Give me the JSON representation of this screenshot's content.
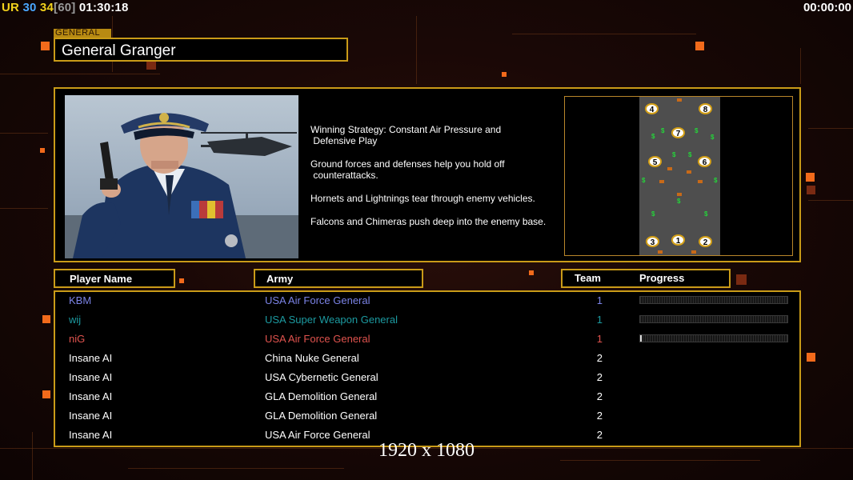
{
  "hud": {
    "ur_label": "UR",
    "value_a": "30",
    "value_b": "34",
    "value_c": "[60]",
    "clock": "01:30:18",
    "timer": "00:00:00"
  },
  "general": {
    "tag": "GENERAL",
    "name": "General Granger",
    "strategy_lines": [
      "Winning Strategy: Constant Air Pressure and\n Defensive Play",
      "Ground forces and defenses help you hold off\n counterattacks.",
      "Hornets and Lightnings tear through enemy vehicles.",
      "Falcons and Chimeras push deep into the enemy base."
    ]
  },
  "minimap": {
    "spots": [
      "1",
      "2",
      "3",
      "4",
      "5",
      "6",
      "7",
      "8"
    ]
  },
  "table": {
    "headers": {
      "player": "Player Name",
      "army": "Army",
      "team": "Team",
      "progress": "Progress"
    },
    "rows": [
      {
        "player": "KBM",
        "army": "USA Air Force General",
        "team": "1",
        "color": "#7b83e6",
        "progress": 0.0
      },
      {
        "player": "wij",
        "army": "USA Super Weapon General",
        "team": "1",
        "color": "#1c9aa0",
        "progress": 0.0
      },
      {
        "player": "niG",
        "army": "USA Air Force General",
        "team": "1",
        "color": "#e0534e",
        "progress": 0.01
      },
      {
        "player": "Insane AI",
        "army": "China Nuke General",
        "team": "2",
        "color": "#ffffff"
      },
      {
        "player": "Insane AI",
        "army": "USA Cybernetic General",
        "team": "2",
        "color": "#ffffff"
      },
      {
        "player": "Insane AI",
        "army": "GLA Demolition General",
        "team": "2",
        "color": "#ffffff"
      },
      {
        "player": "Insane AI",
        "army": "GLA Demolition General",
        "team": "2",
        "color": "#ffffff"
      },
      {
        "player": "Insane AI",
        "army": "USA Air Force General",
        "team": "2",
        "color": "#ffffff"
      }
    ]
  },
  "footer": {
    "resolution": "1920 x 1080"
  },
  "colors": {
    "frame": "#c99b18",
    "accent": "#f26a1b",
    "background": "#1a0806"
  }
}
